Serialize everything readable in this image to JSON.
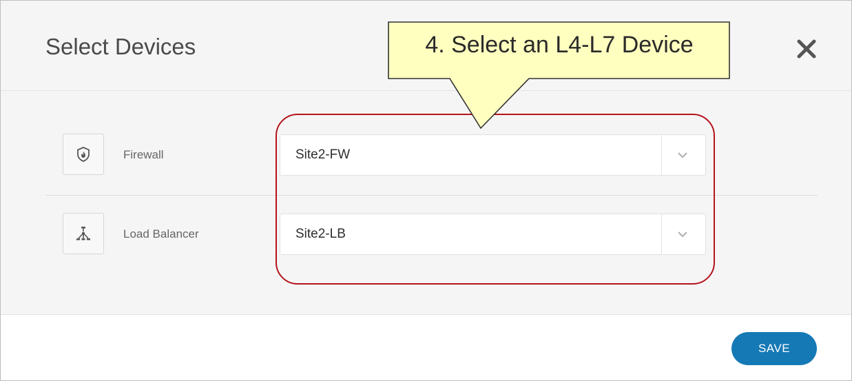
{
  "dialog": {
    "title": "Select Devices",
    "close_icon": "close-icon"
  },
  "devices": [
    {
      "label": "Firewall",
      "icon": "shield-flame-icon",
      "selected": "Site2-FW"
    },
    {
      "label": "Load Balancer",
      "icon": "load-balancer-icon",
      "selected": "Site2-LB"
    }
  ],
  "callout": {
    "text": "4. Select an L4-L7 Device",
    "fill": "#ffffc0",
    "highlight_color": "#b5121b"
  },
  "footer": {
    "save_label": "SAVE"
  },
  "colors": {
    "accent": "#1579b5"
  }
}
